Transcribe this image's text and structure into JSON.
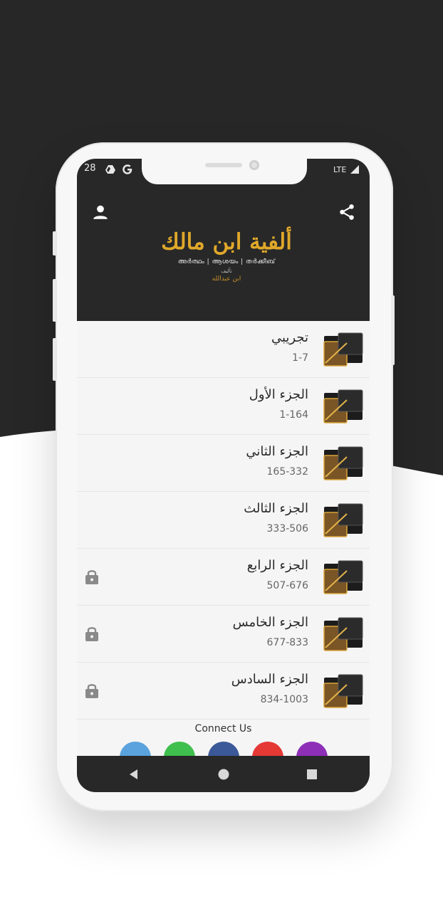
{
  "status_bar": {
    "time_partial": "28",
    "network": "LTE"
  },
  "header": {
    "logo_title": "ألفية ابن مالك",
    "logo_subtitle": "അർത്ഥം | ആശയം | തർക്കീബ്",
    "logo_author_label": "تأليف",
    "logo_author": "ابن عبدالله",
    "profile_icon": "person-icon",
    "share_icon": "share-icon"
  },
  "list": {
    "items": [
      {
        "title": "تجريبي",
        "range": "1-7",
        "locked": false
      },
      {
        "title": "الجزء الأول",
        "range": "1-164",
        "locked": false
      },
      {
        "title": "الجزء الثاني",
        "range": "165-332",
        "locked": false
      },
      {
        "title": "الجزء الثالث",
        "range": "333-506",
        "locked": false
      },
      {
        "title": "الجزء الرابع",
        "range": "507-676",
        "locked": true
      },
      {
        "title": "الجزء الخامس",
        "range": "677-833",
        "locked": true
      },
      {
        "title": "الجزء السادس",
        "range": "834-1003",
        "locked": true
      }
    ]
  },
  "footer": {
    "connect_label": "Connect Us",
    "social": [
      {
        "name": "telegram-icon",
        "color": "#5aa3de"
      },
      {
        "name": "whatsapp-icon",
        "color": "#3fbf4e"
      },
      {
        "name": "facebook-icon",
        "color": "#3b5998"
      },
      {
        "name": "youtube-icon",
        "color": "#e53935"
      },
      {
        "name": "instagram-icon",
        "color": "#8e2fb8"
      }
    ]
  },
  "colors": {
    "header_bg": "#282828",
    "accent_gold": "#e0a82a"
  }
}
